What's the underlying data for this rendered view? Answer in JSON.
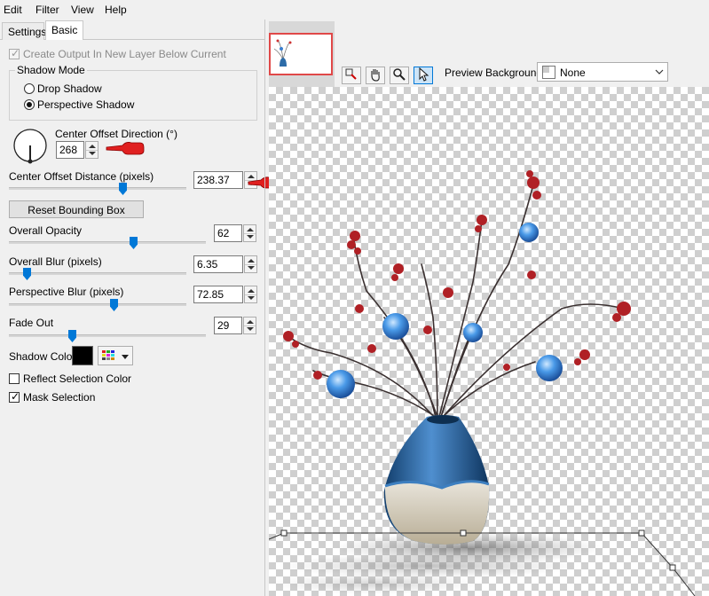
{
  "menu": [
    "Edit",
    "Filter",
    "View",
    "Help"
  ],
  "tabs": [
    {
      "label": "Settings",
      "active": false
    },
    {
      "label": "Basic",
      "active": true
    }
  ],
  "create_output": {
    "label": "Create Output In New Layer Below Current",
    "checked": true,
    "disabled": true
  },
  "shadow_mode": {
    "title": "Shadow Mode",
    "options": [
      {
        "label": "Drop Shadow",
        "selected": false
      },
      {
        "label": "Perspective Shadow",
        "selected": true
      }
    ]
  },
  "center_offset_direction": {
    "label": "Center Offset Direction (°)",
    "value": "268"
  },
  "center_offset_distance": {
    "label": "Center Offset Distance (pixels)",
    "value": "238.37",
    "slider": 0.5
  },
  "reset_button": "Reset Bounding Box",
  "overall_opacity": {
    "label": "Overall Opacity",
    "value": "62",
    "slider": 0.62
  },
  "overall_blur": {
    "label": "Overall Blur (pixels)",
    "value": "6.35",
    "slider": 0.05
  },
  "perspective_blur": {
    "label": "Perspective Blur (pixels)",
    "value": "72.85",
    "slider": 0.6
  },
  "fade_out": {
    "label": "Fade Out",
    "value": "29",
    "slider": 0.29
  },
  "shadow_color": {
    "label": "Shadow Color",
    "color": "#000000"
  },
  "reflect_selection": {
    "label": "Reflect Selection Color",
    "checked": false
  },
  "mask_selection": {
    "label": "Mask Selection",
    "checked": true
  },
  "preview_background": {
    "label": "Preview Background:",
    "value": "None"
  },
  "colors": {
    "accent": "#0078d7",
    "marker": "#e02020",
    "thumb_border": "#e04848"
  },
  "tools": [
    "zoom-fit-icon",
    "hand-icon",
    "magnifier-icon",
    "pointer-icon"
  ]
}
